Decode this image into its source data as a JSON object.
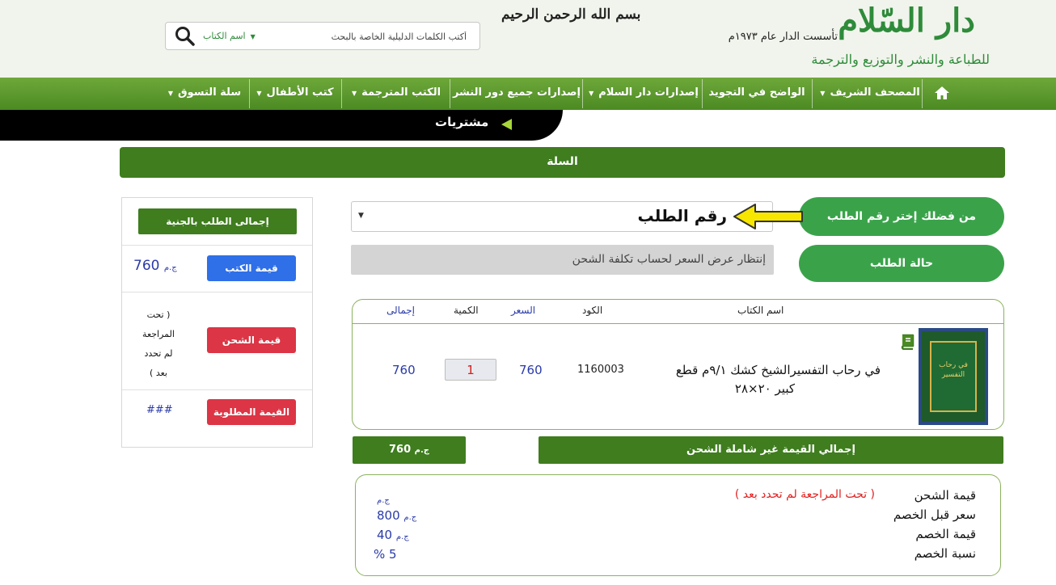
{
  "header": {
    "logo_main": "دار السّلام",
    "logo_since": "تأسست الدار عام ١٩٧٣م",
    "logo_sub": "للطباعة والنشر والتوزيع والترجمة",
    "basmala": "بسم الله الرحمن الرحيم"
  },
  "search": {
    "scope_label": "اسم الكتاب",
    "placeholder": "أكتب الكلمات الدليلية الخاصة بالبحث"
  },
  "nav": {
    "items": [
      {
        "label": "المصحف الشريف",
        "dropdown": true
      },
      {
        "label": "الواضح في التجويد",
        "dropdown": false
      },
      {
        "label": "إصدارات دار السلام",
        "dropdown": true
      },
      {
        "label": "إصدارات جميع دور النشر",
        "dropdown": false
      },
      {
        "label": "الكتب المترجمة",
        "dropdown": true
      },
      {
        "label": "كتب الأطفال",
        "dropdown": true
      },
      {
        "label": "سلة التسوق",
        "dropdown": true
      }
    ]
  },
  "breadcrumb": {
    "label": "مشتريات"
  },
  "cart": {
    "title": "السلة"
  },
  "order": {
    "choose_label": "من فضلك إختر رقم الطلب",
    "select_value": "رقم الطلب",
    "status_label": "حالة الطلب",
    "status_value": "إنتظار عرض السعر لحساب تكلفة الشحن"
  },
  "table": {
    "headers": {
      "name": "اسم الكتاب",
      "code": "الكود",
      "price": "السعر",
      "qty": "الكمية",
      "total": "إجمالى"
    },
    "rows": [
      {
        "name_line1": "في رحاب التفسيرالشيخ كشك ٩/١م قطع",
        "name_line2": "كبير ٢٠×٢٨",
        "cover_title": "في رحاب التفسير",
        "code": "1160003",
        "price": "760",
        "qty": "1",
        "total": "760"
      }
    ]
  },
  "totals": {
    "label": "إجمالي القيمة غير شاملة الشحن",
    "value": "760",
    "currency": "ج.م"
  },
  "breakdown": {
    "shipping_label": "قيمة الشحن",
    "shipping_note": "( تحت المراجعة لم تحدد بعد )",
    "shipping_currency": "ج.م",
    "before_discount_label": "سعر قبل الخصم",
    "before_discount_value": "800",
    "before_discount_currency": "ج.م",
    "discount_label": "قيمة الخصم",
    "discount_value": "40",
    "discount_currency": "ج.م",
    "discount_pct_label": "نسبة الخصم",
    "discount_pct_value": "5",
    "discount_pct_unit": "%"
  },
  "summary": {
    "title": "إجمالى الطلب بالجنية",
    "books_label": "قيمة الكتب",
    "books_value": "760",
    "books_currency": "ج.م",
    "shipping_label": "قيمة الشحن",
    "shipping_note_1": "( تحت",
    "shipping_note_2": "المراجعة",
    "shipping_note_3": "لم تحدد",
    "shipping_note_4": "بعد )",
    "required_label": "القيمة المطلوبة",
    "required_value": "###"
  },
  "colors": {
    "green_dark": "#3f7d1f",
    "green_button": "#3aa34a",
    "blue_button": "#2f6fe8",
    "red_button": "#dc3545",
    "value_blue": "#2a3aa8"
  }
}
